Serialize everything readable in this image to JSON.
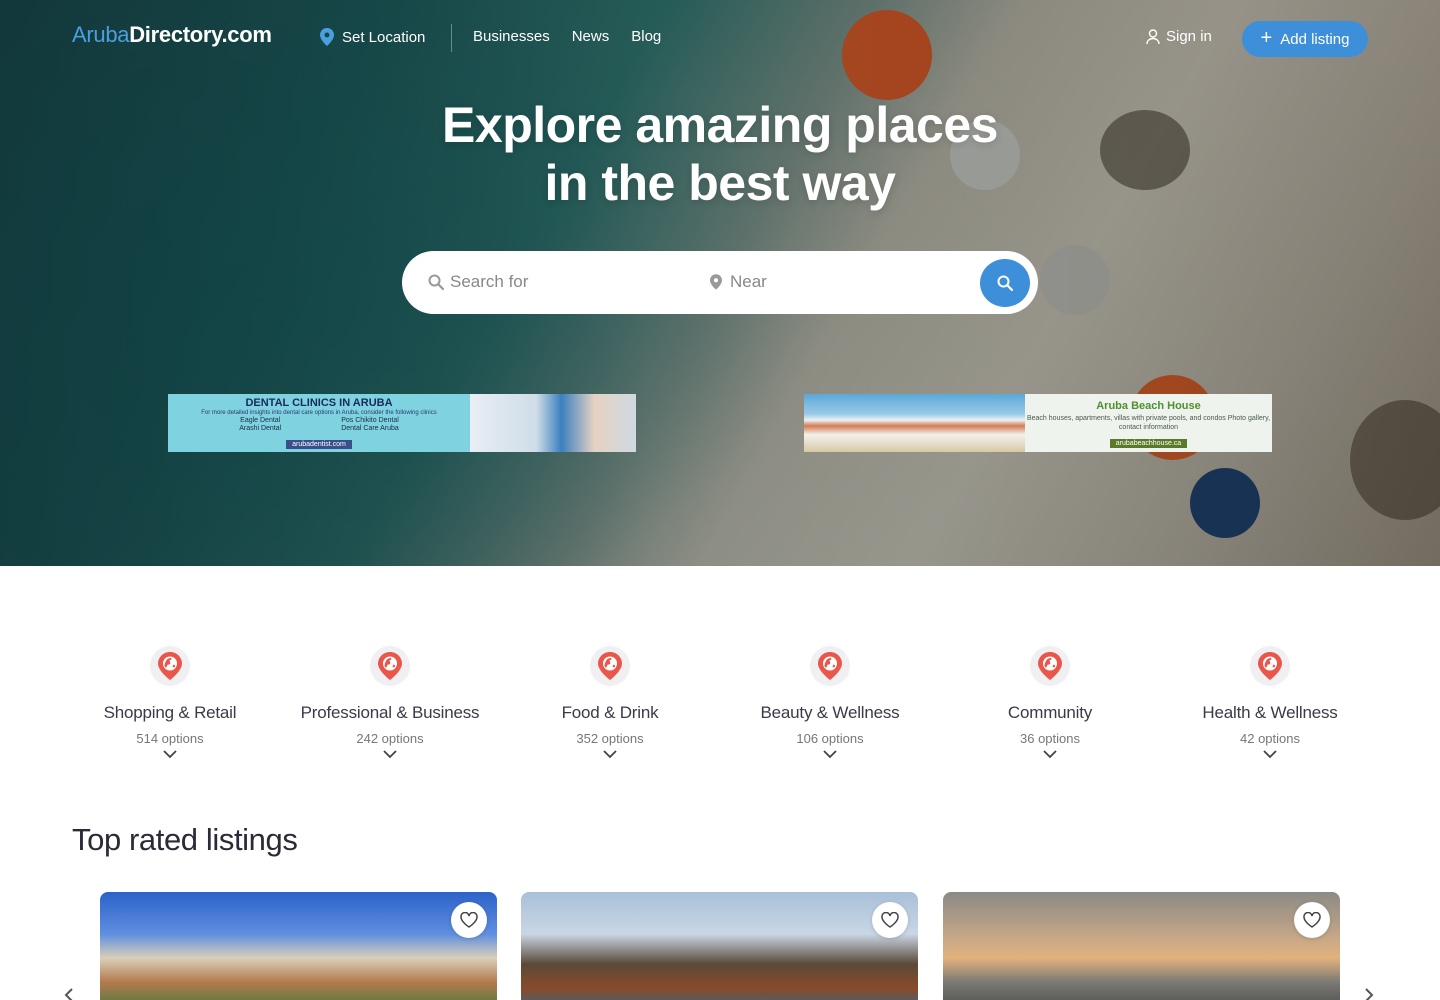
{
  "brand": {
    "part1": "Aruba",
    "part2": "Directory.com"
  },
  "nav": {
    "set_location": "Set Location",
    "links": [
      "Businesses",
      "News",
      "Blog"
    ],
    "sign_in": "Sign in",
    "add_listing": "Add listing"
  },
  "hero": {
    "line1": "Explore amazing places",
    "line2": "in the best way",
    "search_placeholder": "Search for",
    "near_placeholder": "Near"
  },
  "banners": [
    {
      "title": "DENTAL CLINICS IN ARUBA",
      "subtitle": "For more detailed insights into dental care options in Aruba, consider the following clinics",
      "left_items": [
        "Eagle Dental",
        "Arashi Dental"
      ],
      "right_items": [
        "Pos Chikito Dental",
        "Dental Care Aruba"
      ],
      "url": "arubadentist.com"
    },
    {
      "title": "Aruba Beach House",
      "subtitle": "Beach houses, apartments, villas with private pools, and condos Photo gallery, contact information",
      "url": "arubabeachhouse.ca"
    }
  ],
  "categories": [
    {
      "name": "Shopping & Retail",
      "count": "514 options"
    },
    {
      "name": "Professional & Business",
      "count": "242 options"
    },
    {
      "name": "Food & Drink",
      "count": "352 options"
    },
    {
      "name": "Beauty & Wellness",
      "count": "106 options"
    },
    {
      "name": "Community",
      "count": "36 options"
    },
    {
      "name": "Health & Wellness",
      "count": "42 options"
    }
  ],
  "listings": {
    "title": "Top rated listings",
    "cards": [
      {
        "image": "building-photo"
      },
      {
        "image": "restaurant-photo"
      },
      {
        "image": "sunset-beach-photo"
      }
    ]
  },
  "colors": {
    "accent": "#3d8fd9",
    "category_icon": "#e8574a"
  }
}
